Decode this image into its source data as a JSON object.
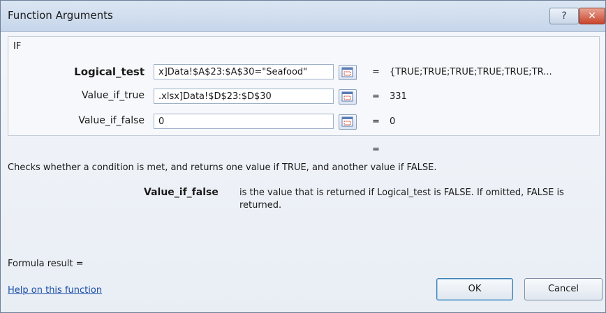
{
  "window": {
    "title": "Function Arguments",
    "help_button": "?",
    "close_button": "✕"
  },
  "function_name": "IF",
  "arguments": [
    {
      "label": "Logical_test",
      "bold": true,
      "value": "x]Data!$A$23:$A$30=\"Seafood\"",
      "equals": "=",
      "result": "{TRUE;TRUE;TRUE;TRUE;TRUE;TR..."
    },
    {
      "label": "Value_if_true",
      "bold": false,
      "value": ".xlsx]Data!$D$23:$D$30",
      "equals": "=",
      "result": "331"
    },
    {
      "label": "Value_if_false",
      "bold": false,
      "value": "0",
      "equals": "=",
      "result": "0"
    }
  ],
  "function_result_equals": "=",
  "description": "Checks whether a condition is met, and returns one value if TRUE, and another value if FALSE.",
  "argument_help": {
    "name": "Value_if_false",
    "text": "is the value that is returned if Logical_test is FALSE. If omitted, FALSE is returned."
  },
  "formula_result_label": "Formula result =",
  "help_link": "Help on this function",
  "buttons": {
    "ok": "OK",
    "cancel": "Cancel"
  },
  "icons": {
    "ref_button": "collapse-dialog-icon"
  }
}
